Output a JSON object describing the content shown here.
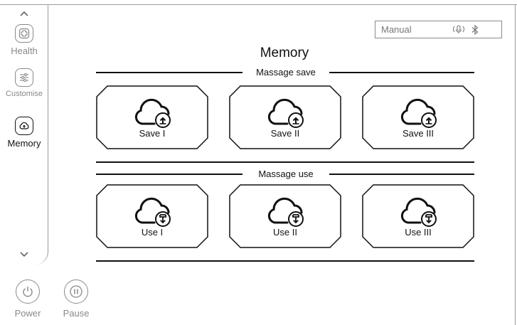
{
  "sidebar": {
    "items": [
      {
        "label": "Health",
        "icon": "health-cross-icon",
        "active": false
      },
      {
        "label": "Customise",
        "icon": "sliders-icon",
        "active": false
      },
      {
        "label": "Memory",
        "icon": "cloud-upload-icon",
        "active": true
      }
    ]
  },
  "controls": {
    "power_label": "Power",
    "pause_label": "Pause"
  },
  "status": {
    "mode": "Manual",
    "icons": [
      "voice-icon",
      "bluetooth-icon"
    ]
  },
  "page": {
    "title": "Memory"
  },
  "sections": {
    "save": {
      "label": "Massage save",
      "cards": [
        {
          "label": "Save I"
        },
        {
          "label": "Save II"
        },
        {
          "label": "Save III"
        }
      ]
    },
    "use": {
      "label": "Massage use",
      "cards": [
        {
          "label": "Use I"
        },
        {
          "label": "Use II"
        },
        {
          "label": "Use III"
        }
      ]
    }
  },
  "colors": {
    "line": "#111111",
    "muted": "#888888",
    "frame": "#9a9a9a"
  }
}
